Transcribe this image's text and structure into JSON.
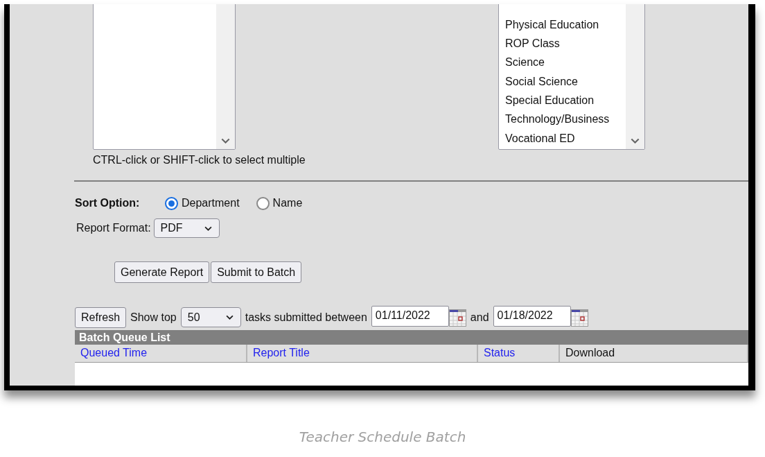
{
  "course_list": {
    "hint": "CTRL-click or SHIFT-click to select multiple"
  },
  "department_list": {
    "items": [
      {
        "label": "Physical Education"
      },
      {
        "label": "ROP Class"
      },
      {
        "label": "Science"
      },
      {
        "label": "Social Science"
      },
      {
        "label": "Special Education"
      },
      {
        "label": "Technology/Business"
      },
      {
        "label": "Vocational ED"
      }
    ]
  },
  "sort_option": {
    "label": "Sort Option:",
    "options": [
      {
        "label": "Department",
        "selected": true
      },
      {
        "label": "Name",
        "selected": false
      }
    ]
  },
  "report_format": {
    "label": "Report Format:",
    "value": "PDF"
  },
  "buttons": [
    "Generate Report",
    "Submit to Batch"
  ],
  "batch_filter": {
    "refresh": "Refresh",
    "show_top_label": "Show top",
    "show_top_value": "50",
    "between_label": "tasks submitted between",
    "start_date": "01/11/2022",
    "and_label": "and",
    "end_date": "01/18/2022"
  },
  "batch_queue": {
    "title": "Batch Queue List",
    "columns": [
      {
        "label": "Queued Time",
        "sortable": true
      },
      {
        "label": "Report Title",
        "sortable": true
      },
      {
        "label": "Status",
        "sortable": true
      },
      {
        "label": "Download",
        "sortable": false
      }
    ]
  },
  "caption": "Teacher Schedule Batch"
}
